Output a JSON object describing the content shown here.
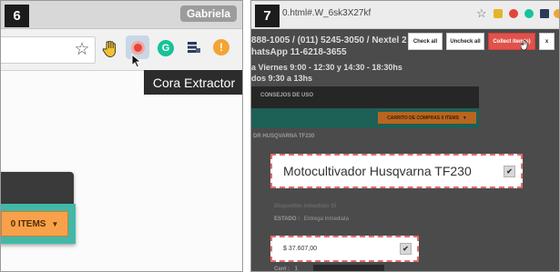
{
  "panel6": {
    "step": "6",
    "profile_name": "Gabriela",
    "tooltip": "Cora Extractor",
    "cart_button": "0 ITEMS",
    "cart_caret": "▼"
  },
  "panel7": {
    "step": "7",
    "url": "0.html#.W_6sk3X27kf",
    "contact_line1": "888-1005 / (011) 5245-3050 / Nextel 2",
    "contact_line2": "hatsApp 11-6218-3655",
    "hours_line1": "a Viernes 9:00 - 12:30 y 14:30 - 18:30hs",
    "hours_line2": "dos 9:30 a 13hs",
    "nav_label": "CONSEJOS DE USO",
    "cart_button": "CARRITO DE COMPRAS 0 ITEMS",
    "cart_caret": "▼",
    "breadcrumb": "DR HUSQVARNA TF230",
    "product_title": "Motocultivador Husqvarna TF230",
    "availability": "Disponible inmediato SÍ",
    "status_label": "ESTADO :",
    "status_value": "Entrega Inmediata",
    "price": "$ 37.607,00",
    "qty_label": "Cant :",
    "qty_value": "1",
    "buttons": {
      "check_all": "Check all",
      "uncheck_all": "Uncheck all",
      "collect": "Collect item(s)",
      "close": "x"
    },
    "check_mark": "✔"
  }
}
